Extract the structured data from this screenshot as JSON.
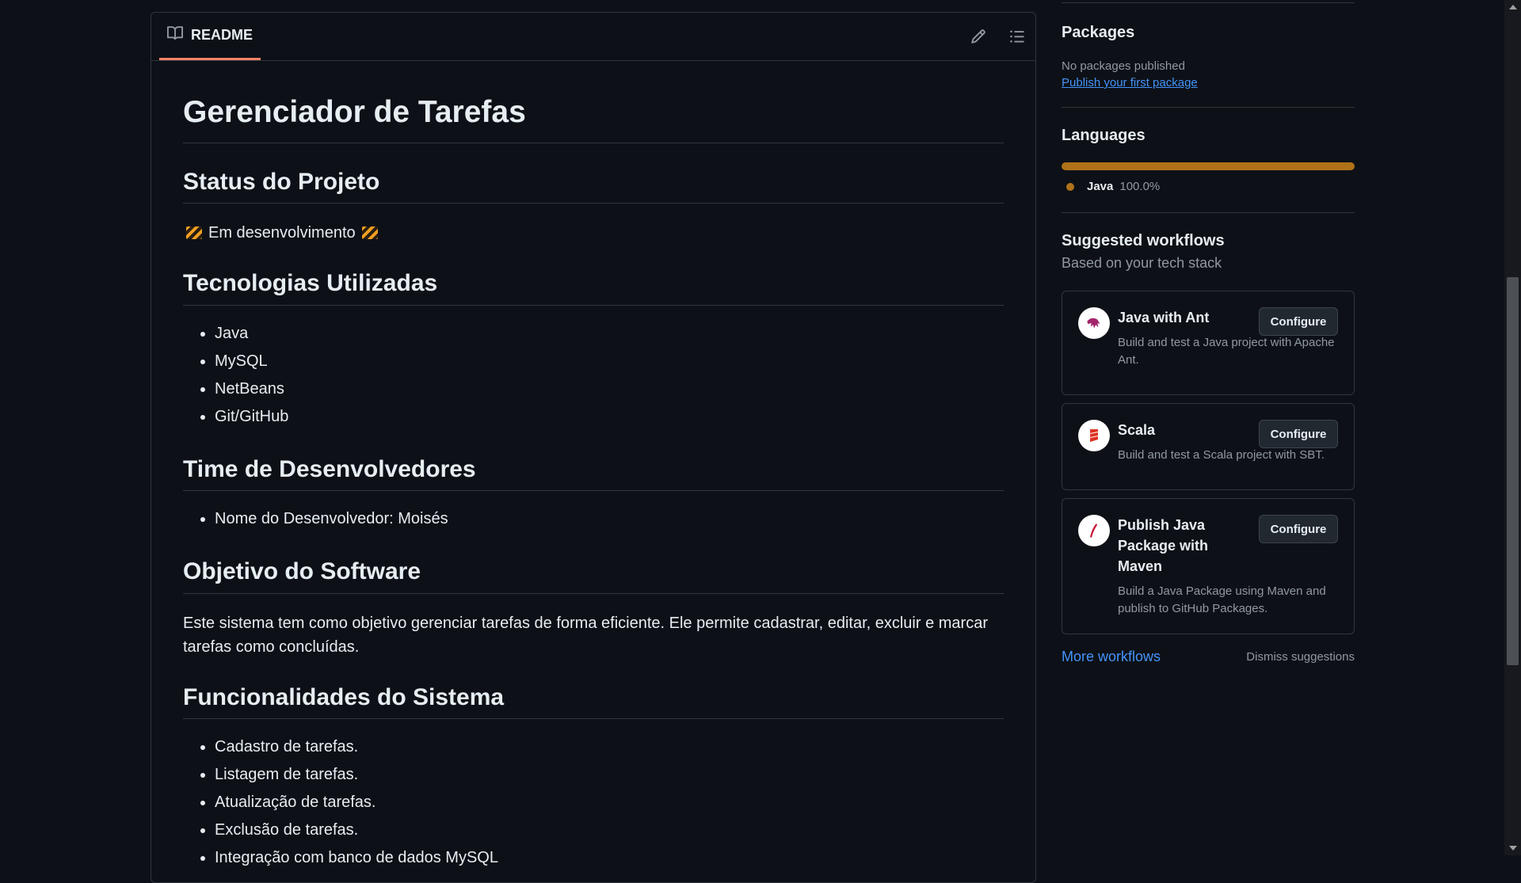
{
  "readme": {
    "tab_label": "README",
    "title": "Gerenciador de Tarefas",
    "sections": {
      "status": {
        "heading": "Status do Projeto",
        "text": "Em desenvolvimento"
      },
      "tech": {
        "heading": "Tecnologias Utilizadas",
        "items": [
          "Java",
          "MySQL",
          "NetBeans",
          "Git/GitHub"
        ]
      },
      "team": {
        "heading": "Time de Desenvolvedores",
        "items": [
          "Nome do Desenvolvedor: Moisés"
        ]
      },
      "goal": {
        "heading": "Objetivo do Software",
        "text": "Este sistema tem como objetivo gerenciar tarefas de forma eficiente. Ele permite cadastrar, editar, excluir e marcar tarefas como concluídas."
      },
      "features": {
        "heading": "Funcionalidades do Sistema",
        "items": [
          "Cadastro de tarefas.",
          "Listagem de tarefas.",
          "Atualização de tarefas.",
          "Exclusão de tarefas.",
          "Integração com banco de dados MySQL"
        ]
      }
    }
  },
  "sidebar": {
    "packages": {
      "heading": "Packages",
      "empty_text": "No packages published",
      "link": "Publish your first package"
    },
    "languages": {
      "heading": "Languages",
      "items": [
        {
          "name": "Java",
          "percent": "100.0%",
          "color": "#b07219"
        }
      ]
    },
    "workflows": {
      "heading": "Suggested workflows",
      "subheading": "Based on your tech stack",
      "button_label": "Configure",
      "items": [
        {
          "title": "Java with Ant",
          "description": "Build and test a Java project with Apache Ant.",
          "icon": "ant-icon"
        },
        {
          "title": "Scala",
          "description": "Build and test a Scala project with SBT.",
          "icon": "scala-icon"
        },
        {
          "title": "Publish Java Package with Maven",
          "description": "Build a Java Package using Maven and publish to GitHub Packages.",
          "icon": "maven-icon"
        }
      ],
      "more_link": "More workflows",
      "dismiss": "Dismiss suggestions"
    }
  },
  "colors": {
    "background": "#0d1117",
    "border": "#30363d",
    "link": "#4493f8",
    "tab_underline": "#f78166",
    "java": "#b07219"
  }
}
